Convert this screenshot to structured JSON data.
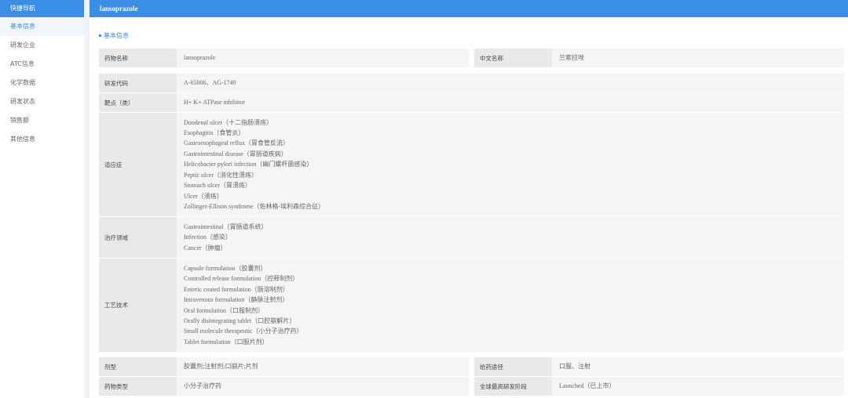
{
  "sidebar": {
    "title": "快捷导航",
    "items": [
      "基本信息",
      "研发企业",
      "ATC信息",
      "化学数据",
      "研发状态",
      "销售额",
      "其他信息"
    ]
  },
  "header": {
    "title": "lansoprazole"
  },
  "section": {
    "title": "基本信息"
  },
  "fields": {
    "drug_name": {
      "label": "药物名称",
      "value": "lansoprazole"
    },
    "cn_name": {
      "label": "中文名称",
      "value": "兰索拉唑"
    },
    "code": {
      "label": "研发代码",
      "value": "A-65006、AG-1749"
    },
    "target": {
      "label": "靶点（类）",
      "value": "H+ K+ ATPase inhibitor"
    },
    "indication": {
      "label": "适应症",
      "values": [
        "Duodenal ulcer（十二指肠溃疡）",
        "Esophagitis（食管炎）",
        "Gastroesophageal reflux（胃食管反流）",
        "Gastrointestinal disease（胃肠道疾病）",
        "Helicobacter pylori infection（幽门螺杆菌感染）",
        "Peptic ulcer（消化性溃疡）",
        "Stomach ulcer（胃溃疡）",
        "Ulcer（溃疡）",
        "Zollinger-Ellison syndrome（佐林格-埃利森综合征）"
      ]
    },
    "area": {
      "label": "治疗领域",
      "values": [
        "Gastrointestinal（胃肠道系统）",
        "Infection（感染）",
        "Cancer（肿瘤）"
      ]
    },
    "tech": {
      "label": "工艺技术",
      "values": [
        "Capsule formulation（胶囊剂）",
        "Controlled release formulation（控释制剂）",
        "Enteric coated formulation（肠溶制剂）",
        "Intravenous formulation（静脉注射剂）",
        "Oral formulation（口服制剂）",
        "Orally disintegrating tablet（口腔崩解片）",
        "Small molecule therapeutic（小分子治疗药）",
        "Tablet formulation（口服片剂）"
      ]
    },
    "form": {
      "label": "剂型",
      "value": "胶囊剂;注射剂;口崩片;片剂"
    },
    "route": {
      "label": "给药途径",
      "value": "口服、注射"
    },
    "type": {
      "label": "药物类型",
      "value": "小分子治疗药"
    },
    "phase": {
      "label": "全球最高研发阶段",
      "value": "Launched（已上市）"
    }
  }
}
